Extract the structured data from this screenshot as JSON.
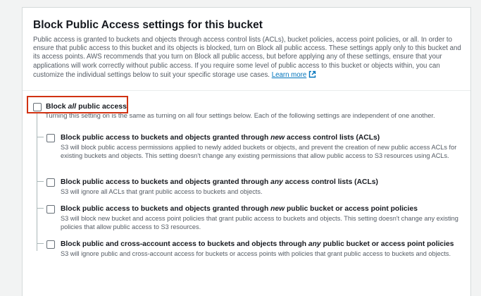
{
  "section": {
    "title": "Block Public Access settings for this bucket",
    "description": "Public access is granted to buckets and objects through access control lists (ACLs), bucket policies, access point policies, or all. In order to ensure that public access to this bucket and its objects is blocked, turn on Block all public access. These settings apply only to this bucket and its access points. AWS recommends that you turn on Block all public access, but before applying any of these settings, ensure that your applications will work correctly without public access. If you require some level of public access to this bucket or objects within, you can customize the individual settings below to suit your specific storage use cases.",
    "learn_more": "Learn more"
  },
  "block_all": {
    "label_pre": "Block ",
    "label_em": "all",
    "label_post": " public access",
    "description": "Turning this setting on is the same as turning on all four settings below. Each of the following settings are independent of one another.",
    "checked": false
  },
  "options": [
    {
      "label_pre": "Block public access to buckets and objects granted through ",
      "label_em": "new",
      "label_post": " access control lists (ACLs)",
      "description": "S3 will block public access permissions applied to newly added buckets or objects, and prevent the creation of new public access ACLs for existing buckets and objects. This setting doesn't change any existing permissions that allow public access to S3 resources using ACLs.",
      "checked": false
    },
    {
      "label_pre": "Block public access to buckets and objects granted through ",
      "label_em": "any",
      "label_post": " access control lists (ACLs)",
      "description": "S3 will ignore all ACLs that grant public access to buckets and objects.",
      "checked": false
    },
    {
      "label_pre": "Block public access to buckets and objects granted through ",
      "label_em": "new",
      "label_post": " public bucket or access point policies",
      "description": "S3 will block new bucket and access point policies that grant public access to buckets and objects. This setting doesn't change any existing policies that allow public access to S3 resources.",
      "checked": false
    },
    {
      "label_pre": "Block public and cross-account access to buckets and objects through ",
      "label_em": "any",
      "label_post": " public bucket or access point policies",
      "description": "S3 will ignore public and cross-account access for buckets or access points with policies that grant public access to buckets and objects.",
      "checked": false
    }
  ],
  "colors": {
    "link": "#0073bb",
    "highlight": "#d13212"
  },
  "icons": {
    "learn_more": "external-link-icon"
  }
}
